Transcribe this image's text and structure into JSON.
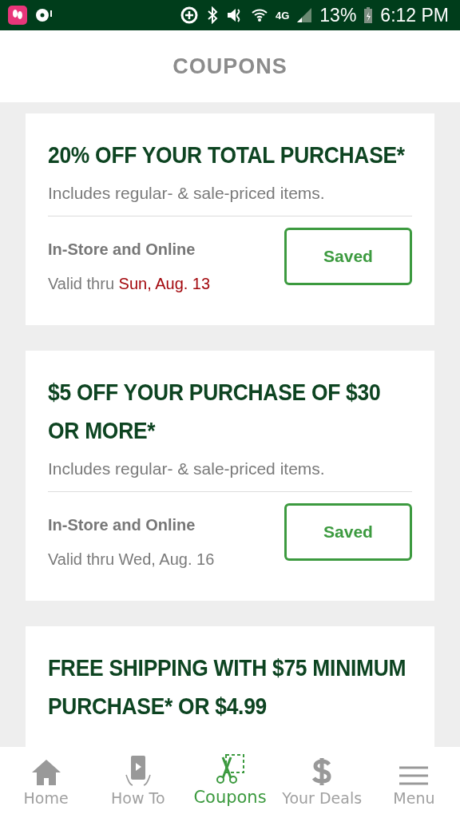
{
  "status_bar": {
    "network": "4G",
    "battery": "13%",
    "time": "6:12 PM"
  },
  "header": {
    "title": "COUPONS"
  },
  "coupons": [
    {
      "title": "20% OFF YOUR TOTAL PURCHASE*",
      "subtitle": "Includes regular- & sale-priced items.",
      "channel": "In-Store and Online",
      "valid_prefix": "Valid thru",
      "valid_date": "Sun, Aug. 13",
      "expiring_soon": true,
      "button": "Saved"
    },
    {
      "title": "$5 OFF YOUR PURCHASE OF $30 OR MORE*",
      "subtitle": "Includes regular- & sale-priced items.",
      "channel": "In-Store and Online",
      "valid_prefix": "Valid thru",
      "valid_date": "Wed, Aug. 16",
      "expiring_soon": false,
      "button": "Saved"
    },
    {
      "title": "FREE SHIPPING WITH $75 MINIMUM PURCHASE* OR $4.99"
    }
  ],
  "nav": [
    {
      "label": "Home",
      "kind": "home",
      "selected": false
    },
    {
      "label": "How To",
      "kind": "howto",
      "selected": false
    },
    {
      "label": "Coupons",
      "kind": "coupons",
      "selected": true
    },
    {
      "label": "Your Deals",
      "kind": "deals",
      "selected": false
    },
    {
      "label": "Menu",
      "kind": "menu",
      "selected": false
    }
  ]
}
